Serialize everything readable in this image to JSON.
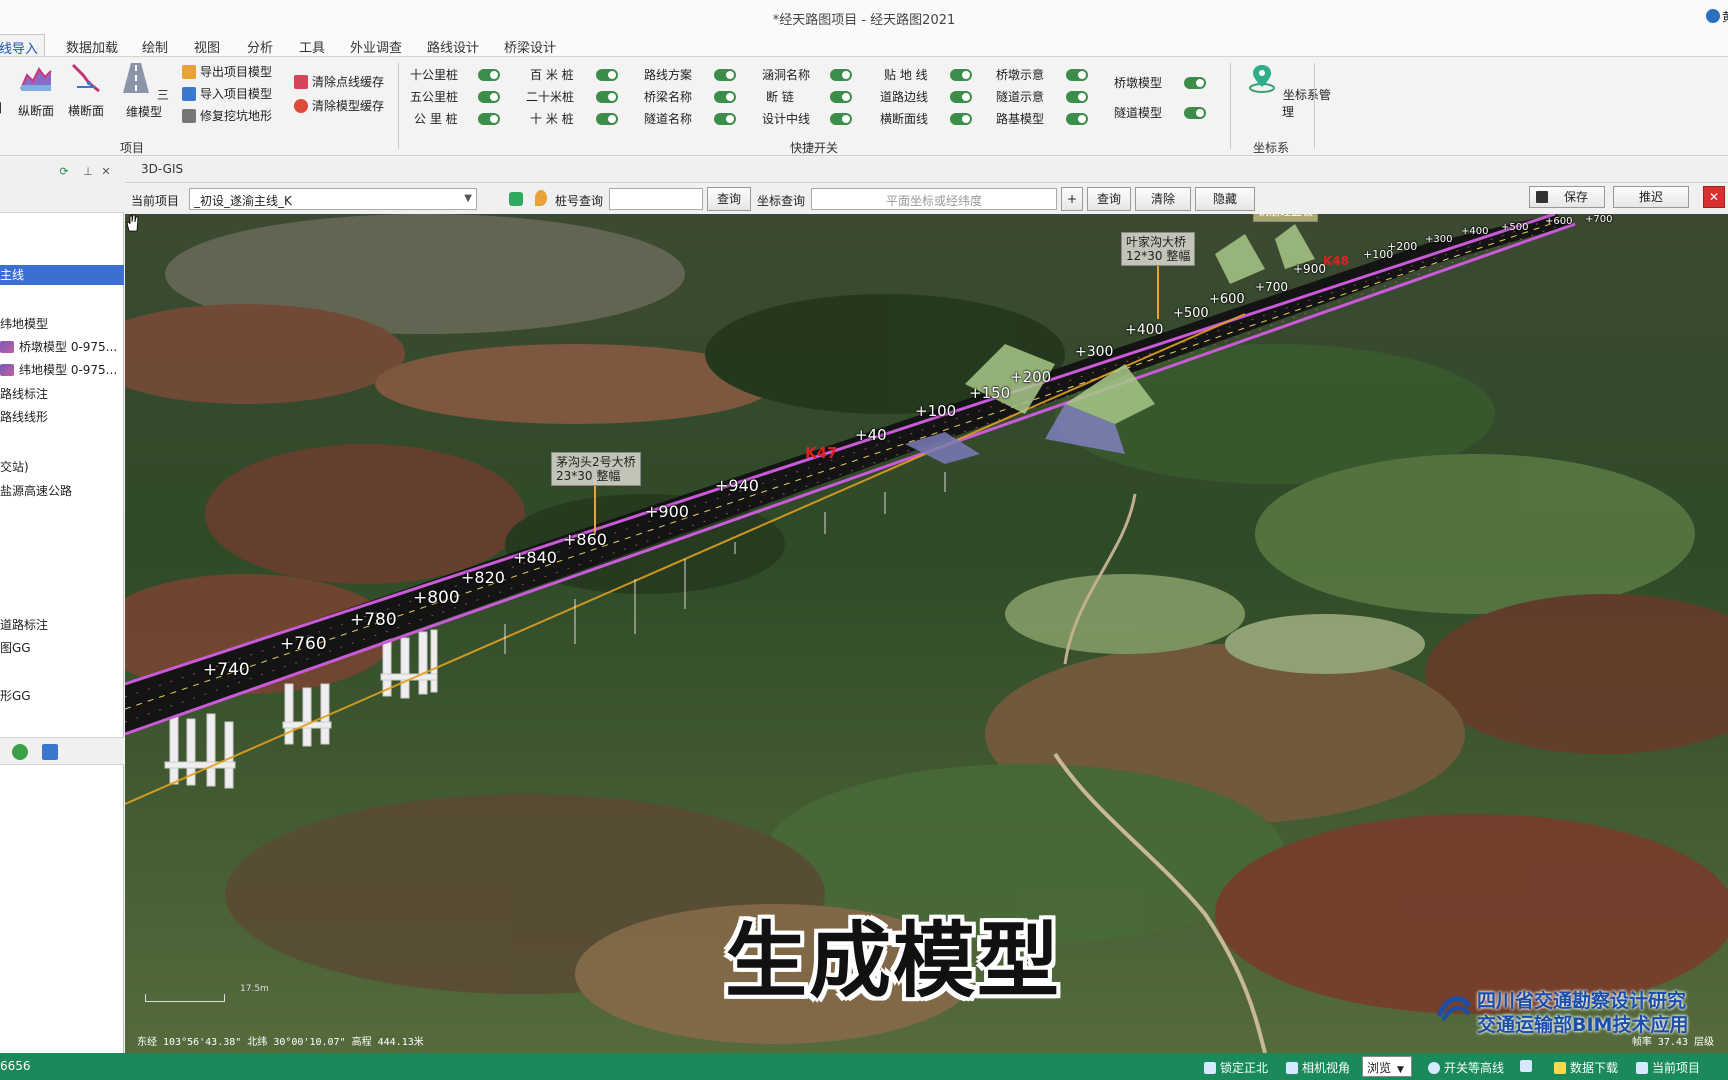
{
  "titlebar": {
    "title": "*经天路图项目 - 经天路图2021",
    "user": "黄"
  },
  "tabs": [
    {
      "label": "线导入"
    },
    {
      "label": "数据加载"
    },
    {
      "label": "绘制"
    },
    {
      "label": "视图"
    },
    {
      "label": "分析"
    },
    {
      "label": "工具"
    },
    {
      "label": "外业调查"
    },
    {
      "label": "路线设计"
    },
    {
      "label": "桥梁设计"
    }
  ],
  "ribbon": {
    "project_group": {
      "label": "项目",
      "big_buttons": [
        {
          "label": "图",
          "icon": "map-icon"
        },
        {
          "label": "纵断面",
          "icon": "profile-icon"
        },
        {
          "label": "横断面",
          "icon": "cross-section-icon"
        },
        {
          "label": "三维模型",
          "icon": "road-3d-icon"
        }
      ],
      "small_buttons": [
        {
          "label": "导出项目模型",
          "icon": "export-icon"
        },
        {
          "label": "导入项目模型",
          "icon": "import-icon"
        },
        {
          "label": "修复挖坑地形",
          "icon": "repair-icon"
        },
        {
          "label": "清除点线缓存",
          "icon": "eraser-icon"
        },
        {
          "label": "清除模型缓存",
          "icon": "clear-icon"
        }
      ]
    },
    "quick_switch": {
      "label": "快捷开关",
      "toggles": [
        {
          "label": "十公里桩"
        },
        {
          "label": "五公里桩"
        },
        {
          "label": "公 里 桩"
        },
        {
          "label": "百 米 桩"
        },
        {
          "label": "二十米桩"
        },
        {
          "label": "十 米 桩"
        },
        {
          "label": "路线方案"
        },
        {
          "label": "桥梁名称"
        },
        {
          "label": "隧道名称"
        },
        {
          "label": "涵洞名称"
        },
        {
          "label": "断 链"
        },
        {
          "label": "设计中线"
        },
        {
          "label": "贴 地 线"
        },
        {
          "label": "道路边线"
        },
        {
          "label": "横断面线"
        },
        {
          "label": "桥墩示意"
        },
        {
          "label": "隧道示意"
        },
        {
          "label": "路基模型"
        },
        {
          "label": "桥墩模型"
        },
        {
          "label": "隧道模型"
        }
      ]
    },
    "coord_group": {
      "label": "坐标系",
      "button": "坐标系管理"
    }
  },
  "left_panel": {
    "items": [
      {
        "label": "主线",
        "selected": true
      },
      {
        "label": "纬地模型"
      },
      {
        "label": "桥墩模型 0-975..."
      },
      {
        "label": "纬地模型 0-975..."
      },
      {
        "label": "路线标注"
      },
      {
        "label": "路线线形"
      },
      {
        "label": "交站)"
      },
      {
        "label": "盐源高速公路"
      },
      {
        "label": "道路标注"
      },
      {
        "label": "图GG"
      },
      {
        "label": "形GG"
      }
    ]
  },
  "viewport": {
    "tab": "3D-GIS",
    "query": {
      "project_label": "当前项目",
      "project_value": "_初设_遂渝主线_K",
      "pile_label": "桩号查询",
      "pile_value": "",
      "pile_button": "查询",
      "coord_label": "坐标查询",
      "coord_placeholder": "平面坐标或经纬度",
      "plus": "+",
      "coord_button": "查询",
      "clear_button": "清除",
      "hide_button": "隐藏",
      "save_button": "保存",
      "back_button": "推迟"
    },
    "stations": [
      "+740",
      "+760",
      "+780",
      "+800",
      "+820",
      "+840",
      "+860",
      "+900",
      "+940",
      "K47",
      "+40",
      "+100",
      "+150",
      "+200",
      "+300",
      "+400",
      "+500",
      "+600",
      "+700",
      "+900",
      "K48",
      "+100",
      "+200",
      "+300",
      "+400",
      "+500",
      "+600",
      "+700"
    ],
    "bridges": [
      {
        "name": "茅沟头2号大桥",
        "spec": "23*30 整幅"
      },
      {
        "name": "叶家沟大桥",
        "spec": "12*30 整幅"
      },
      {
        "name": "钢筋砼盖板"
      }
    ],
    "caption": "生成模型",
    "coords": "东经 103°56'43.38\" 北纬 30°00'10.07\" 高程 444.13米",
    "zoom": "帧率 37.43  层级",
    "watermark_line1": "四川省交通勘察设计研究",
    "watermark_line2": "交通运输部BIM技术应用",
    "scale": "17.5m"
  },
  "statusbar": {
    "left": "6656",
    "lock_north": "锁定正北",
    "camera_view": "相机视角",
    "view_mode": "浏览",
    "contour": "开关等高线",
    "data_download": "数据下载",
    "current_project": "当前项目"
  },
  "colors": {
    "accent": "#3b6fd1",
    "status_bar": "#1a8a5a",
    "road_edge": "#c95ad8",
    "toggle_on": "#3c8c4a"
  }
}
